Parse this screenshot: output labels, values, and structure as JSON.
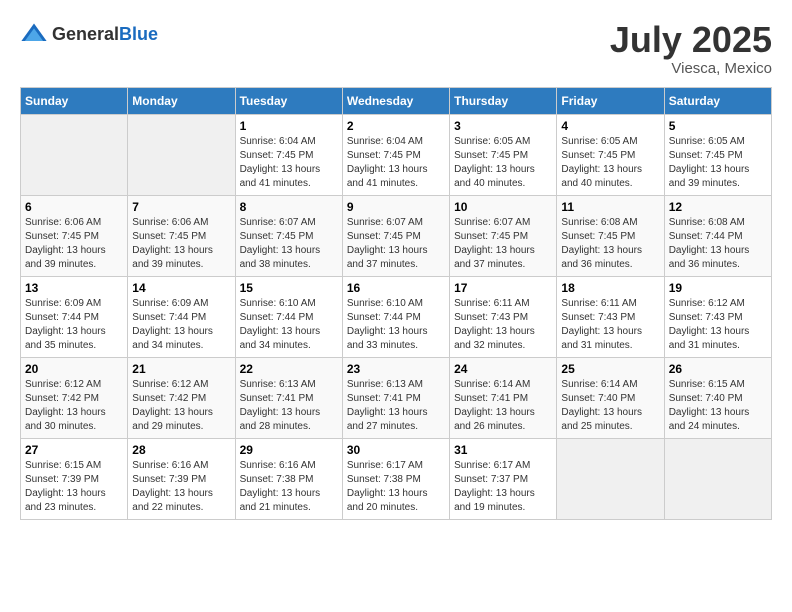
{
  "header": {
    "logo_general": "General",
    "logo_blue": "Blue",
    "month": "July 2025",
    "location": "Viesca, Mexico"
  },
  "weekdays": [
    "Sunday",
    "Monday",
    "Tuesday",
    "Wednesday",
    "Thursday",
    "Friday",
    "Saturday"
  ],
  "weeks": [
    [
      {
        "day": "",
        "sunrise": "",
        "sunset": "",
        "daylight": "",
        "empty": true
      },
      {
        "day": "",
        "sunrise": "",
        "sunset": "",
        "daylight": "",
        "empty": true
      },
      {
        "day": "1",
        "sunrise": "Sunrise: 6:04 AM",
        "sunset": "Sunset: 7:45 PM",
        "daylight": "Daylight: 13 hours and 41 minutes."
      },
      {
        "day": "2",
        "sunrise": "Sunrise: 6:04 AM",
        "sunset": "Sunset: 7:45 PM",
        "daylight": "Daylight: 13 hours and 41 minutes."
      },
      {
        "day": "3",
        "sunrise": "Sunrise: 6:05 AM",
        "sunset": "Sunset: 7:45 PM",
        "daylight": "Daylight: 13 hours and 40 minutes."
      },
      {
        "day": "4",
        "sunrise": "Sunrise: 6:05 AM",
        "sunset": "Sunset: 7:45 PM",
        "daylight": "Daylight: 13 hours and 40 minutes."
      },
      {
        "day": "5",
        "sunrise": "Sunrise: 6:05 AM",
        "sunset": "Sunset: 7:45 PM",
        "daylight": "Daylight: 13 hours and 39 minutes."
      }
    ],
    [
      {
        "day": "6",
        "sunrise": "Sunrise: 6:06 AM",
        "sunset": "Sunset: 7:45 PM",
        "daylight": "Daylight: 13 hours and 39 minutes."
      },
      {
        "day": "7",
        "sunrise": "Sunrise: 6:06 AM",
        "sunset": "Sunset: 7:45 PM",
        "daylight": "Daylight: 13 hours and 39 minutes."
      },
      {
        "day": "8",
        "sunrise": "Sunrise: 6:07 AM",
        "sunset": "Sunset: 7:45 PM",
        "daylight": "Daylight: 13 hours and 38 minutes."
      },
      {
        "day": "9",
        "sunrise": "Sunrise: 6:07 AM",
        "sunset": "Sunset: 7:45 PM",
        "daylight": "Daylight: 13 hours and 37 minutes."
      },
      {
        "day": "10",
        "sunrise": "Sunrise: 6:07 AM",
        "sunset": "Sunset: 7:45 PM",
        "daylight": "Daylight: 13 hours and 37 minutes."
      },
      {
        "day": "11",
        "sunrise": "Sunrise: 6:08 AM",
        "sunset": "Sunset: 7:45 PM",
        "daylight": "Daylight: 13 hours and 36 minutes."
      },
      {
        "day": "12",
        "sunrise": "Sunrise: 6:08 AM",
        "sunset": "Sunset: 7:44 PM",
        "daylight": "Daylight: 13 hours and 36 minutes."
      }
    ],
    [
      {
        "day": "13",
        "sunrise": "Sunrise: 6:09 AM",
        "sunset": "Sunset: 7:44 PM",
        "daylight": "Daylight: 13 hours and 35 minutes."
      },
      {
        "day": "14",
        "sunrise": "Sunrise: 6:09 AM",
        "sunset": "Sunset: 7:44 PM",
        "daylight": "Daylight: 13 hours and 34 minutes."
      },
      {
        "day": "15",
        "sunrise": "Sunrise: 6:10 AM",
        "sunset": "Sunset: 7:44 PM",
        "daylight": "Daylight: 13 hours and 34 minutes."
      },
      {
        "day": "16",
        "sunrise": "Sunrise: 6:10 AM",
        "sunset": "Sunset: 7:44 PM",
        "daylight": "Daylight: 13 hours and 33 minutes."
      },
      {
        "day": "17",
        "sunrise": "Sunrise: 6:11 AM",
        "sunset": "Sunset: 7:43 PM",
        "daylight": "Daylight: 13 hours and 32 minutes."
      },
      {
        "day": "18",
        "sunrise": "Sunrise: 6:11 AM",
        "sunset": "Sunset: 7:43 PM",
        "daylight": "Daylight: 13 hours and 31 minutes."
      },
      {
        "day": "19",
        "sunrise": "Sunrise: 6:12 AM",
        "sunset": "Sunset: 7:43 PM",
        "daylight": "Daylight: 13 hours and 31 minutes."
      }
    ],
    [
      {
        "day": "20",
        "sunrise": "Sunrise: 6:12 AM",
        "sunset": "Sunset: 7:42 PM",
        "daylight": "Daylight: 13 hours and 30 minutes."
      },
      {
        "day": "21",
        "sunrise": "Sunrise: 6:12 AM",
        "sunset": "Sunset: 7:42 PM",
        "daylight": "Daylight: 13 hours and 29 minutes."
      },
      {
        "day": "22",
        "sunrise": "Sunrise: 6:13 AM",
        "sunset": "Sunset: 7:41 PM",
        "daylight": "Daylight: 13 hours and 28 minutes."
      },
      {
        "day": "23",
        "sunrise": "Sunrise: 6:13 AM",
        "sunset": "Sunset: 7:41 PM",
        "daylight": "Daylight: 13 hours and 27 minutes."
      },
      {
        "day": "24",
        "sunrise": "Sunrise: 6:14 AM",
        "sunset": "Sunset: 7:41 PM",
        "daylight": "Daylight: 13 hours and 26 minutes."
      },
      {
        "day": "25",
        "sunrise": "Sunrise: 6:14 AM",
        "sunset": "Sunset: 7:40 PM",
        "daylight": "Daylight: 13 hours and 25 minutes."
      },
      {
        "day": "26",
        "sunrise": "Sunrise: 6:15 AM",
        "sunset": "Sunset: 7:40 PM",
        "daylight": "Daylight: 13 hours and 24 minutes."
      }
    ],
    [
      {
        "day": "27",
        "sunrise": "Sunrise: 6:15 AM",
        "sunset": "Sunset: 7:39 PM",
        "daylight": "Daylight: 13 hours and 23 minutes."
      },
      {
        "day": "28",
        "sunrise": "Sunrise: 6:16 AM",
        "sunset": "Sunset: 7:39 PM",
        "daylight": "Daylight: 13 hours and 22 minutes."
      },
      {
        "day": "29",
        "sunrise": "Sunrise: 6:16 AM",
        "sunset": "Sunset: 7:38 PM",
        "daylight": "Daylight: 13 hours and 21 minutes."
      },
      {
        "day": "30",
        "sunrise": "Sunrise: 6:17 AM",
        "sunset": "Sunset: 7:38 PM",
        "daylight": "Daylight: 13 hours and 20 minutes."
      },
      {
        "day": "31",
        "sunrise": "Sunrise: 6:17 AM",
        "sunset": "Sunset: 7:37 PM",
        "daylight": "Daylight: 13 hours and 19 minutes."
      },
      {
        "day": "",
        "sunrise": "",
        "sunset": "",
        "daylight": "",
        "empty": true
      },
      {
        "day": "",
        "sunrise": "",
        "sunset": "",
        "daylight": "",
        "empty": true
      }
    ]
  ]
}
